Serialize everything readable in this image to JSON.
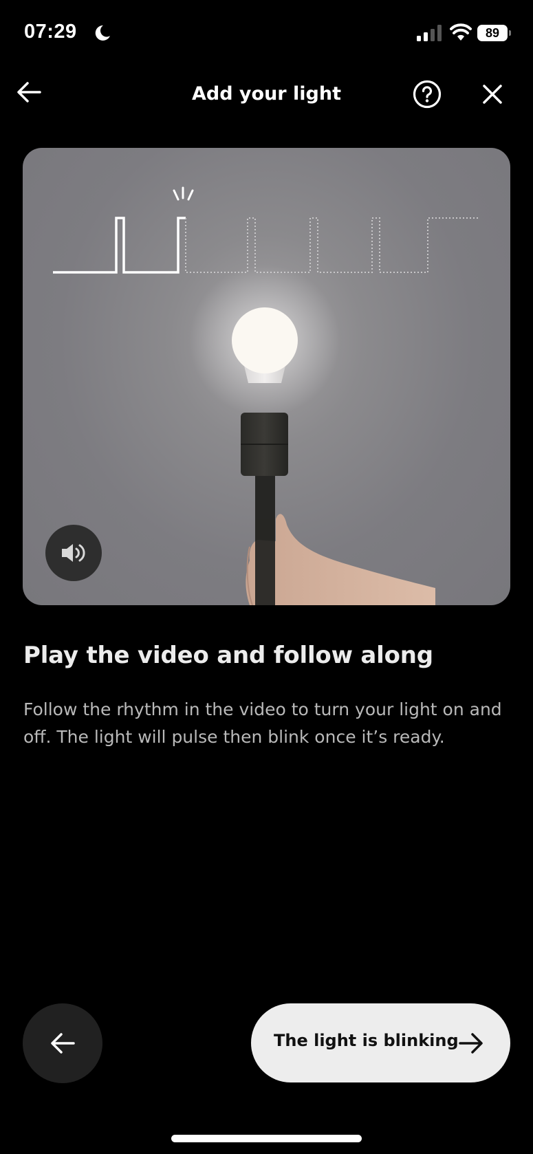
{
  "status_bar": {
    "time": "07:29",
    "focus_icon": "moon-icon",
    "signal_bars_active": 2,
    "signal_bars_total": 4,
    "wifi_icon": "wifi-icon",
    "battery_level": "89"
  },
  "header": {
    "title": "Add your light",
    "back_icon": "arrow-left-icon",
    "help_icon": "help-circle-icon",
    "close_icon": "close-icon"
  },
  "video": {
    "description": "Hand holding a lamp with glowing bulb; on/off rhythm waveform overlay",
    "sound_icon": "speaker-icon",
    "waveform": {
      "completed_steps": [
        "off",
        "on",
        "off",
        "on"
      ],
      "remaining_steps": [
        "off",
        "on",
        "off",
        "on",
        "off",
        "on",
        "off",
        "on"
      ]
    }
  },
  "content": {
    "heading": "Play the video and follow along",
    "body": "Follow the rhythm in the video to turn your light on and off. The light will pulse then blink once it’s ready."
  },
  "footer": {
    "back_icon": "arrow-left-icon",
    "primary_label": "The light is blinking",
    "primary_icon": "arrow-right-icon"
  },
  "colors": {
    "background": "#000000",
    "video_bg": "#7d7c81",
    "primary_button_bg": "#ededed",
    "secondary_button_bg": "#212121",
    "body_text": "#b9b9b9"
  }
}
